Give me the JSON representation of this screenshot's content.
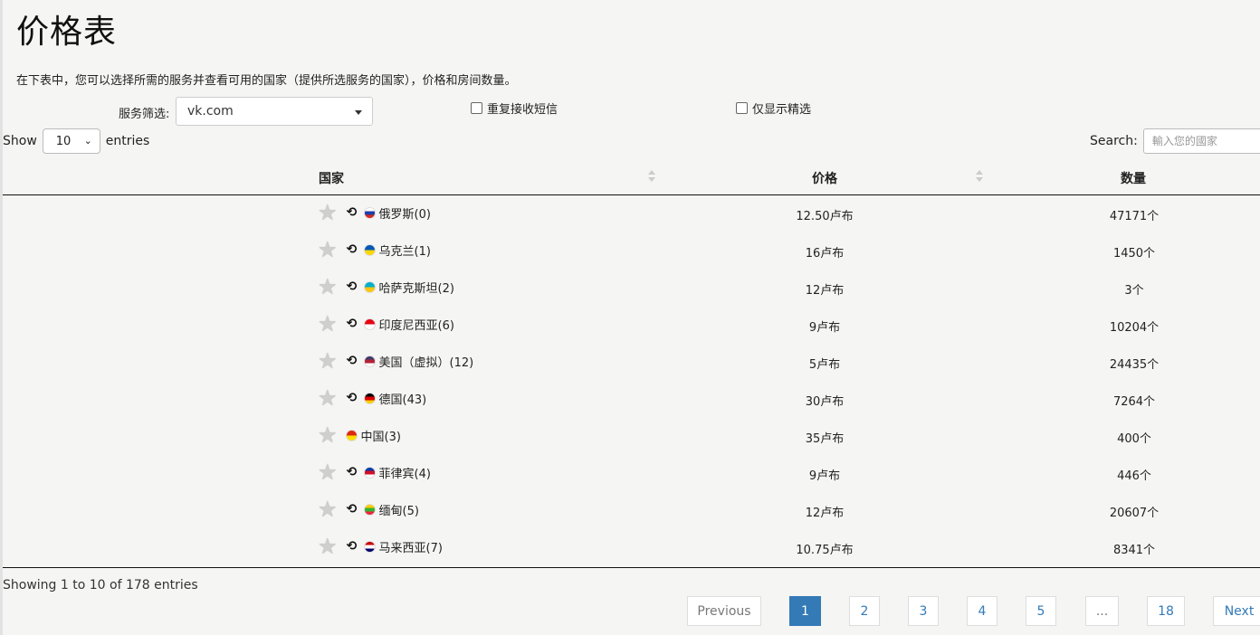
{
  "title": "价格表",
  "intro": "在下表中，您可以选择所需的服务并查看可用的国家（提供所选服务的国家），价格和房间数量。",
  "filter": {
    "label": "服务筛选:",
    "value": "vk.com"
  },
  "checkboxes": {
    "repeat_sms": "重复接收短信",
    "featured_only": "仅显示精选"
  },
  "length": {
    "show": "Show",
    "value": "10",
    "entries": "entries"
  },
  "search": {
    "label": "Search:",
    "placeholder": "輸入您的國家"
  },
  "columns": {
    "country": "国家",
    "price": "价格",
    "quantity": "数量"
  },
  "rows": [
    {
      "country": "俄罗斯(0)",
      "price": "12.50卢布",
      "qty": "47171个",
      "refresh": true,
      "flag_colors": [
        "#ffffff",
        "#1c3fa8",
        "#d52b1e"
      ]
    },
    {
      "country": "乌克兰(1)",
      "price": "16卢布",
      "qty": "1450个",
      "refresh": true,
      "flag_colors": [
        "#0057b7",
        "#ffd700"
      ]
    },
    {
      "country": "哈萨克斯坦(2)",
      "price": "12卢布",
      "qty": "3个",
      "refresh": true,
      "flag_colors": [
        "#00afca",
        "#fec50c"
      ]
    },
    {
      "country": "印度尼西亚(6)",
      "price": "9卢布",
      "qty": "10204个",
      "refresh": true,
      "flag_colors": [
        "#e70011",
        "#ffffff"
      ]
    },
    {
      "country": "美国（虚拟）(12)",
      "price": "5卢布",
      "qty": "24435个",
      "refresh": true,
      "flag_colors": [
        "#3c3b6e",
        "#b22234",
        "#ffffff"
      ]
    },
    {
      "country": "德国(43)",
      "price": "30卢布",
      "qty": "7264个",
      "refresh": true,
      "flag_colors": [
        "#000000",
        "#dd0000",
        "#ffce00"
      ]
    },
    {
      "country": "中国(3)",
      "price": "35卢布",
      "qty": "400个",
      "refresh": false,
      "flag_colors": [
        "#de2910",
        "#ffde00"
      ]
    },
    {
      "country": "菲律宾(4)",
      "price": "9卢布",
      "qty": "446个",
      "refresh": true,
      "flag_colors": [
        "#0038a8",
        "#ce1126",
        "#ffffff"
      ]
    },
    {
      "country": "缅甸(5)",
      "price": "12卢布",
      "qty": "20607个",
      "refresh": true,
      "flag_colors": [
        "#fecb00",
        "#34b233",
        "#ea2839"
      ]
    },
    {
      "country": "马来西亚(7)",
      "price": "10.75卢布",
      "qty": "8341个",
      "refresh": true,
      "flag_colors": [
        "#cc0001",
        "#ffffff",
        "#010066"
      ]
    }
  ],
  "info": "Showing 1 to 10 of 178 entries",
  "pagination": {
    "previous": "Previous",
    "pages": [
      "1",
      "2",
      "3",
      "4",
      "5",
      "...",
      "18"
    ],
    "active": "1",
    "next": "Next"
  },
  "icons": {
    "star": "star-icon",
    "refresh": "refresh-icon",
    "flag": "flag-icon"
  }
}
